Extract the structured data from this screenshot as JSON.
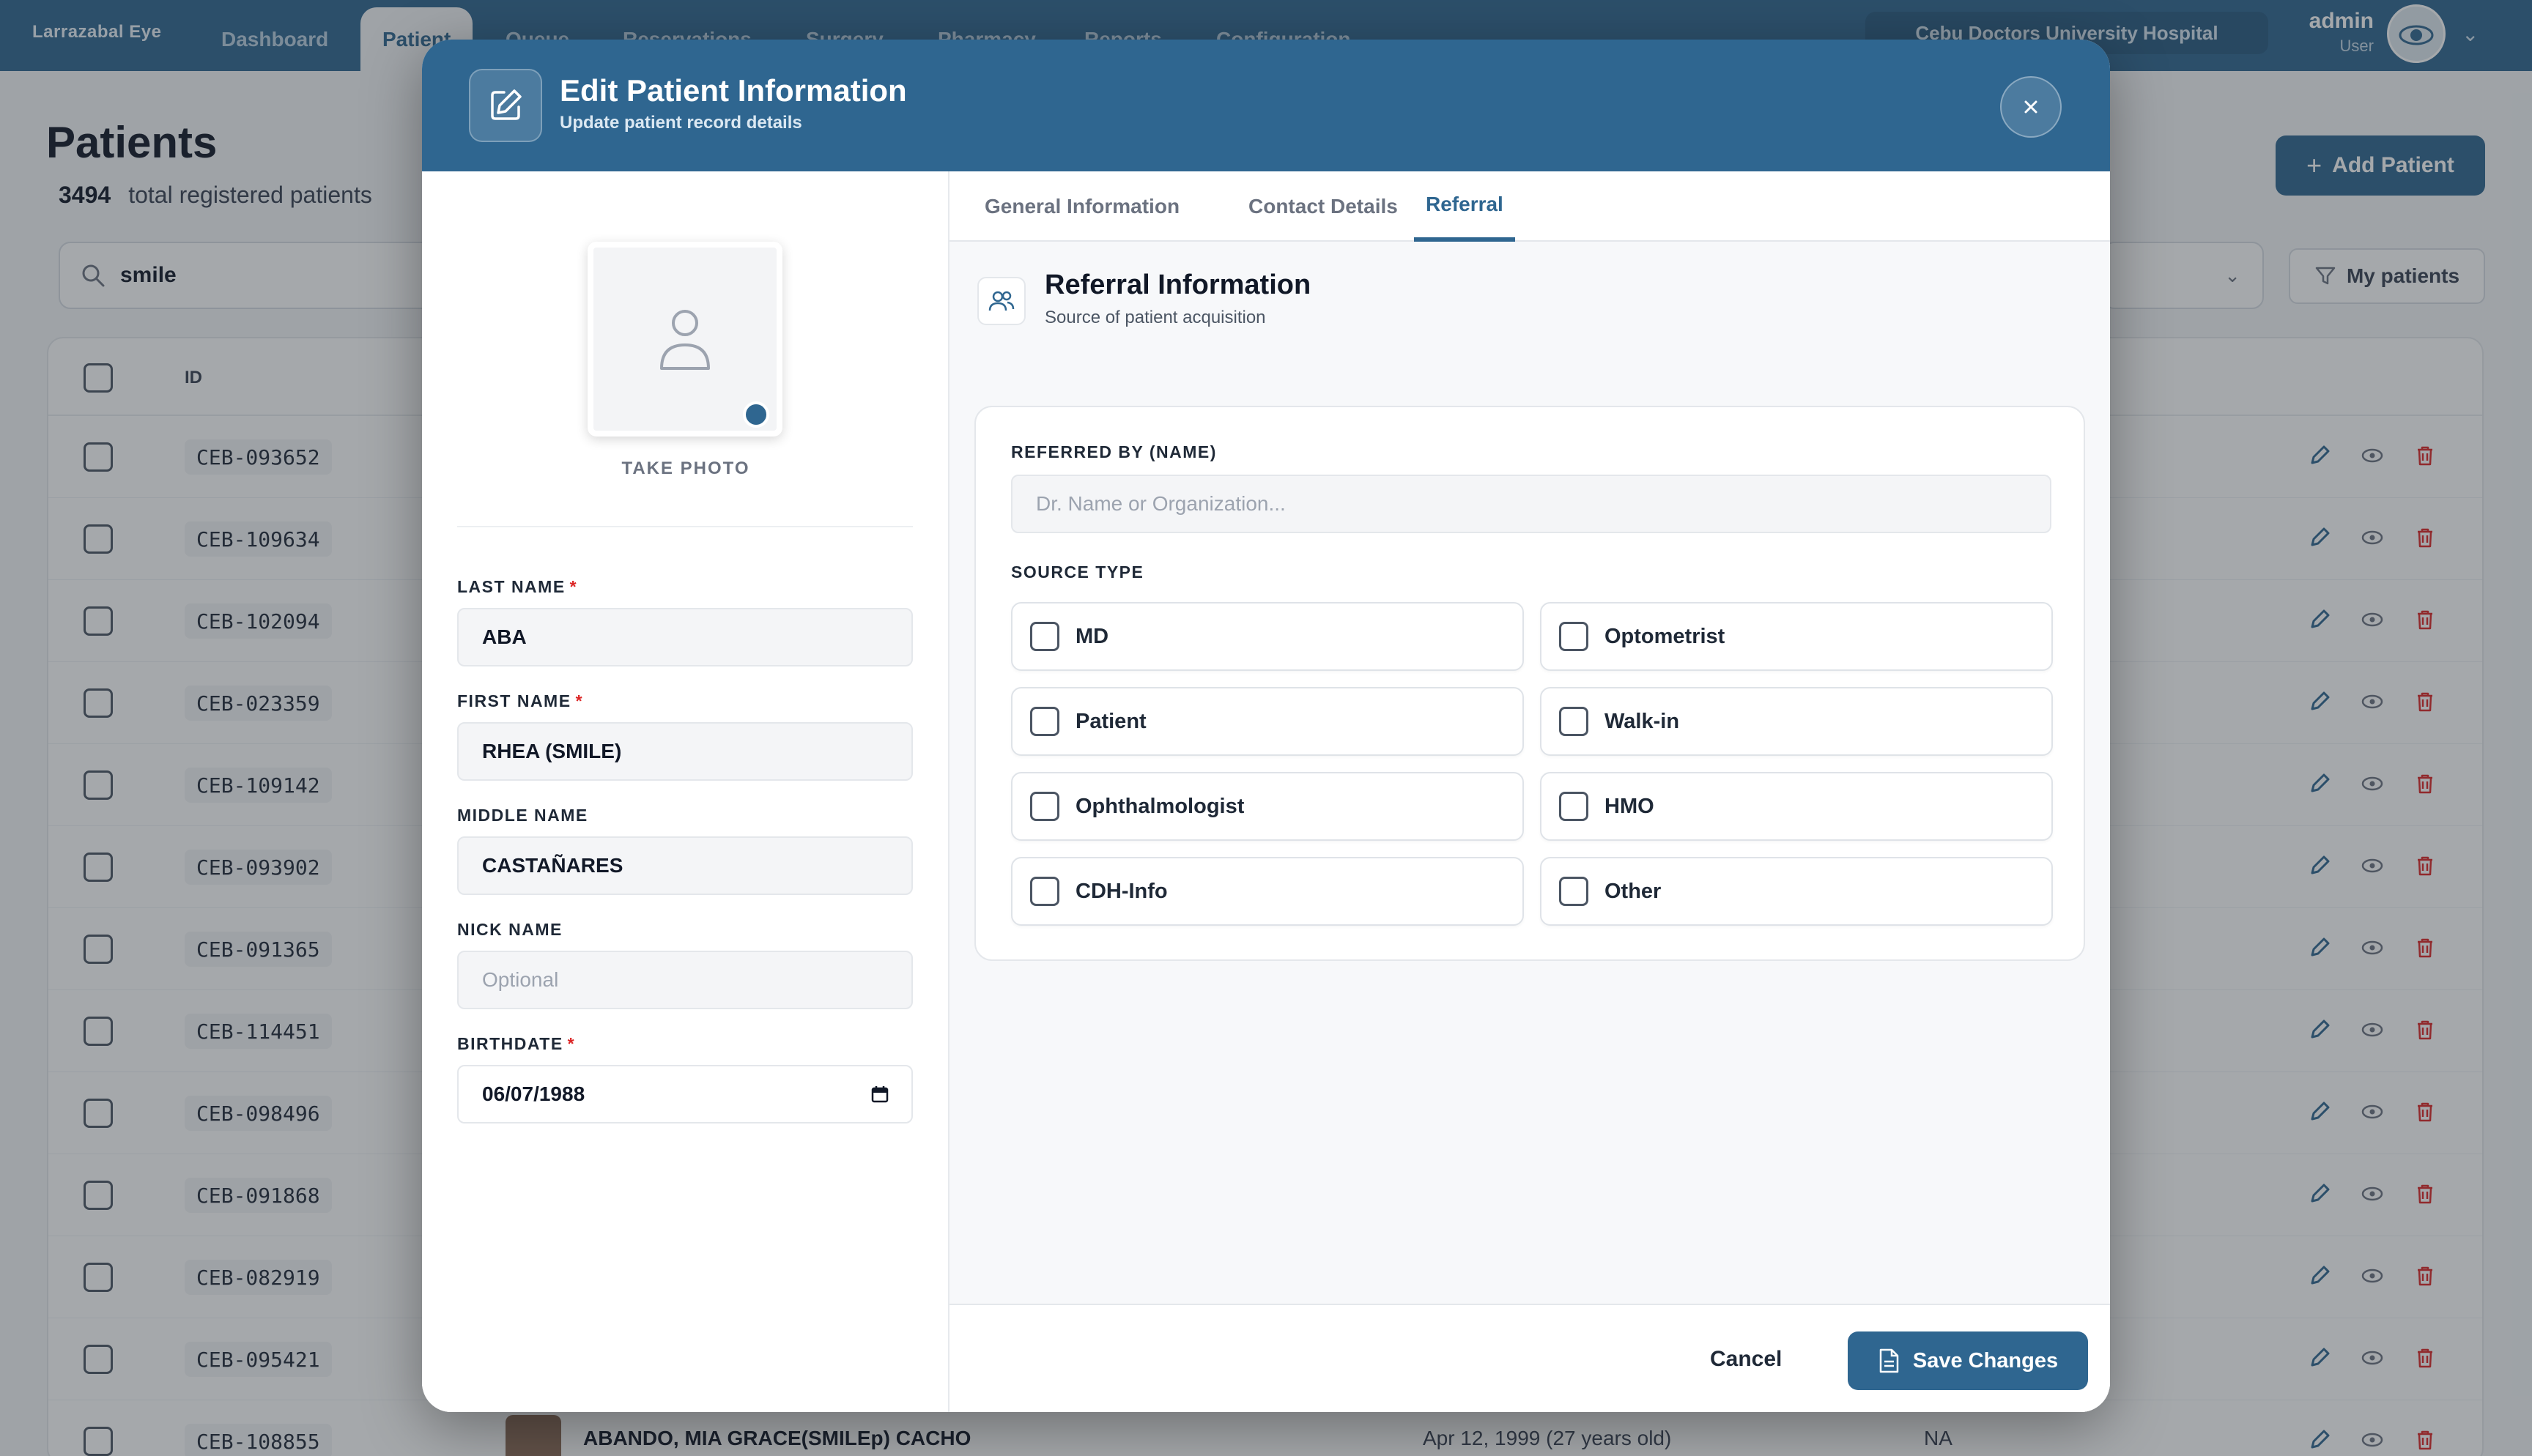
{
  "app": {
    "brand": "Larrazabal Eye",
    "nav_tabs": [
      "Dashboard",
      "Patient",
      "Queue",
      "Reservations",
      "Surgery",
      "Pharmacy",
      "Reports",
      "Configuration"
    ],
    "hospital": "Cebu Doctors University Hospital",
    "user_name": "admin",
    "user_role": "User"
  },
  "page": {
    "title": "Patients",
    "count": "3494",
    "count_label": "total registered patients",
    "add_button": "Add Patient",
    "search_value": "smile",
    "my_patients_button": "My patients",
    "id_header": "ID",
    "rows": [
      {
        "id": "CEB-093652"
      },
      {
        "id": "CEB-109634"
      },
      {
        "id": "CEB-102094"
      },
      {
        "id": "CEB-023359"
      },
      {
        "id": "CEB-109142"
      },
      {
        "id": "CEB-093902"
      },
      {
        "id": "CEB-091365"
      },
      {
        "id": "CEB-114451"
      },
      {
        "id": "CEB-098496"
      },
      {
        "id": "CEB-091868"
      },
      {
        "id": "CEB-082919"
      },
      {
        "id": "CEB-095421"
      },
      {
        "id": "CEB-108855",
        "name": "ABANDO, MIA GRACE(SMILEp) CACHO",
        "birthdate": "Apr 12, 1999 (27 years old)",
        "hmo": "NA"
      }
    ]
  },
  "modal": {
    "title": "Edit Patient Information",
    "subtitle": "Update patient record details",
    "take_photo": "TAKE PHOTO",
    "fields": {
      "last_name": {
        "label": "LAST NAME",
        "value": "ABA"
      },
      "first_name": {
        "label": "FIRST NAME",
        "value": "RHEA (SMILE)"
      },
      "middle_name": {
        "label": "MIDDLE NAME",
        "value": "CASTAÑARES"
      },
      "nick_name": {
        "label": "NICK NAME",
        "placeholder": "Optional"
      },
      "birthdate": {
        "label": "BIRTHDATE",
        "value": "06/07/1988"
      }
    },
    "required_mark": "*",
    "tabs": [
      "General Information",
      "Contact Details",
      "Referral"
    ],
    "active_tab": "Referral",
    "section_title": "Referral Information",
    "section_subtitle": "Source of patient acquisition",
    "referred_by_label": "REFERRED BY (NAME)",
    "referred_by_placeholder": "Dr. Name or Organization...",
    "source_type_label": "SOURCE TYPE",
    "source_options": [
      "MD",
      "Optometrist",
      "Patient",
      "Walk-in",
      "Ophthalmologist",
      "HMO",
      "CDH-Info",
      "Other"
    ],
    "cancel_button": "Cancel",
    "save_button": "Save Changes"
  },
  "colors": {
    "primary": "#2f6690",
    "danger": "#dc2626",
    "overlay": "rgba(40,48,56,0.42)"
  }
}
